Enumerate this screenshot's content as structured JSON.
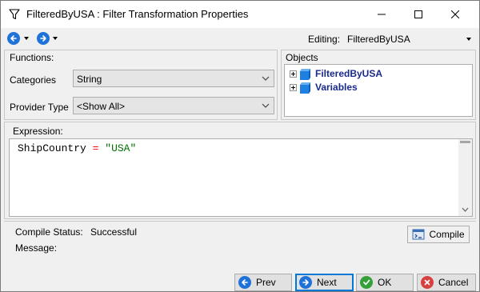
{
  "window": {
    "title": "FilteredByUSA : Filter Transformation Properties"
  },
  "toolbar": {
    "editing_label": "Editing:",
    "editing_value": "FilteredByUSA"
  },
  "functions": {
    "title": "Functions:",
    "categories_label": "Categories",
    "categories_value": "String",
    "provider_label": "Provider Type",
    "provider_value": "<Show All>"
  },
  "objects": {
    "title": "Objects",
    "items": [
      {
        "label": "FilteredByUSA"
      },
      {
        "label": "Variables"
      }
    ]
  },
  "expression": {
    "title": "Expression:",
    "code": {
      "field": "ShipCountry",
      "operator": "=",
      "literal": "\"USA\""
    }
  },
  "status": {
    "compile_status_label": "Compile Status:",
    "compile_status_value": "Successful",
    "message_label": "Message:",
    "compile_button": "Compile"
  },
  "buttons": {
    "prev": "Prev",
    "next": "Next",
    "ok": "OK",
    "cancel": "Cancel"
  },
  "colors": {
    "accent": "#1e72d8",
    "ok": "#36a038",
    "cancel": "#d84040",
    "tree_text": "#1a2a8c",
    "code_operator": "#ff0000",
    "code_string": "#007000"
  }
}
